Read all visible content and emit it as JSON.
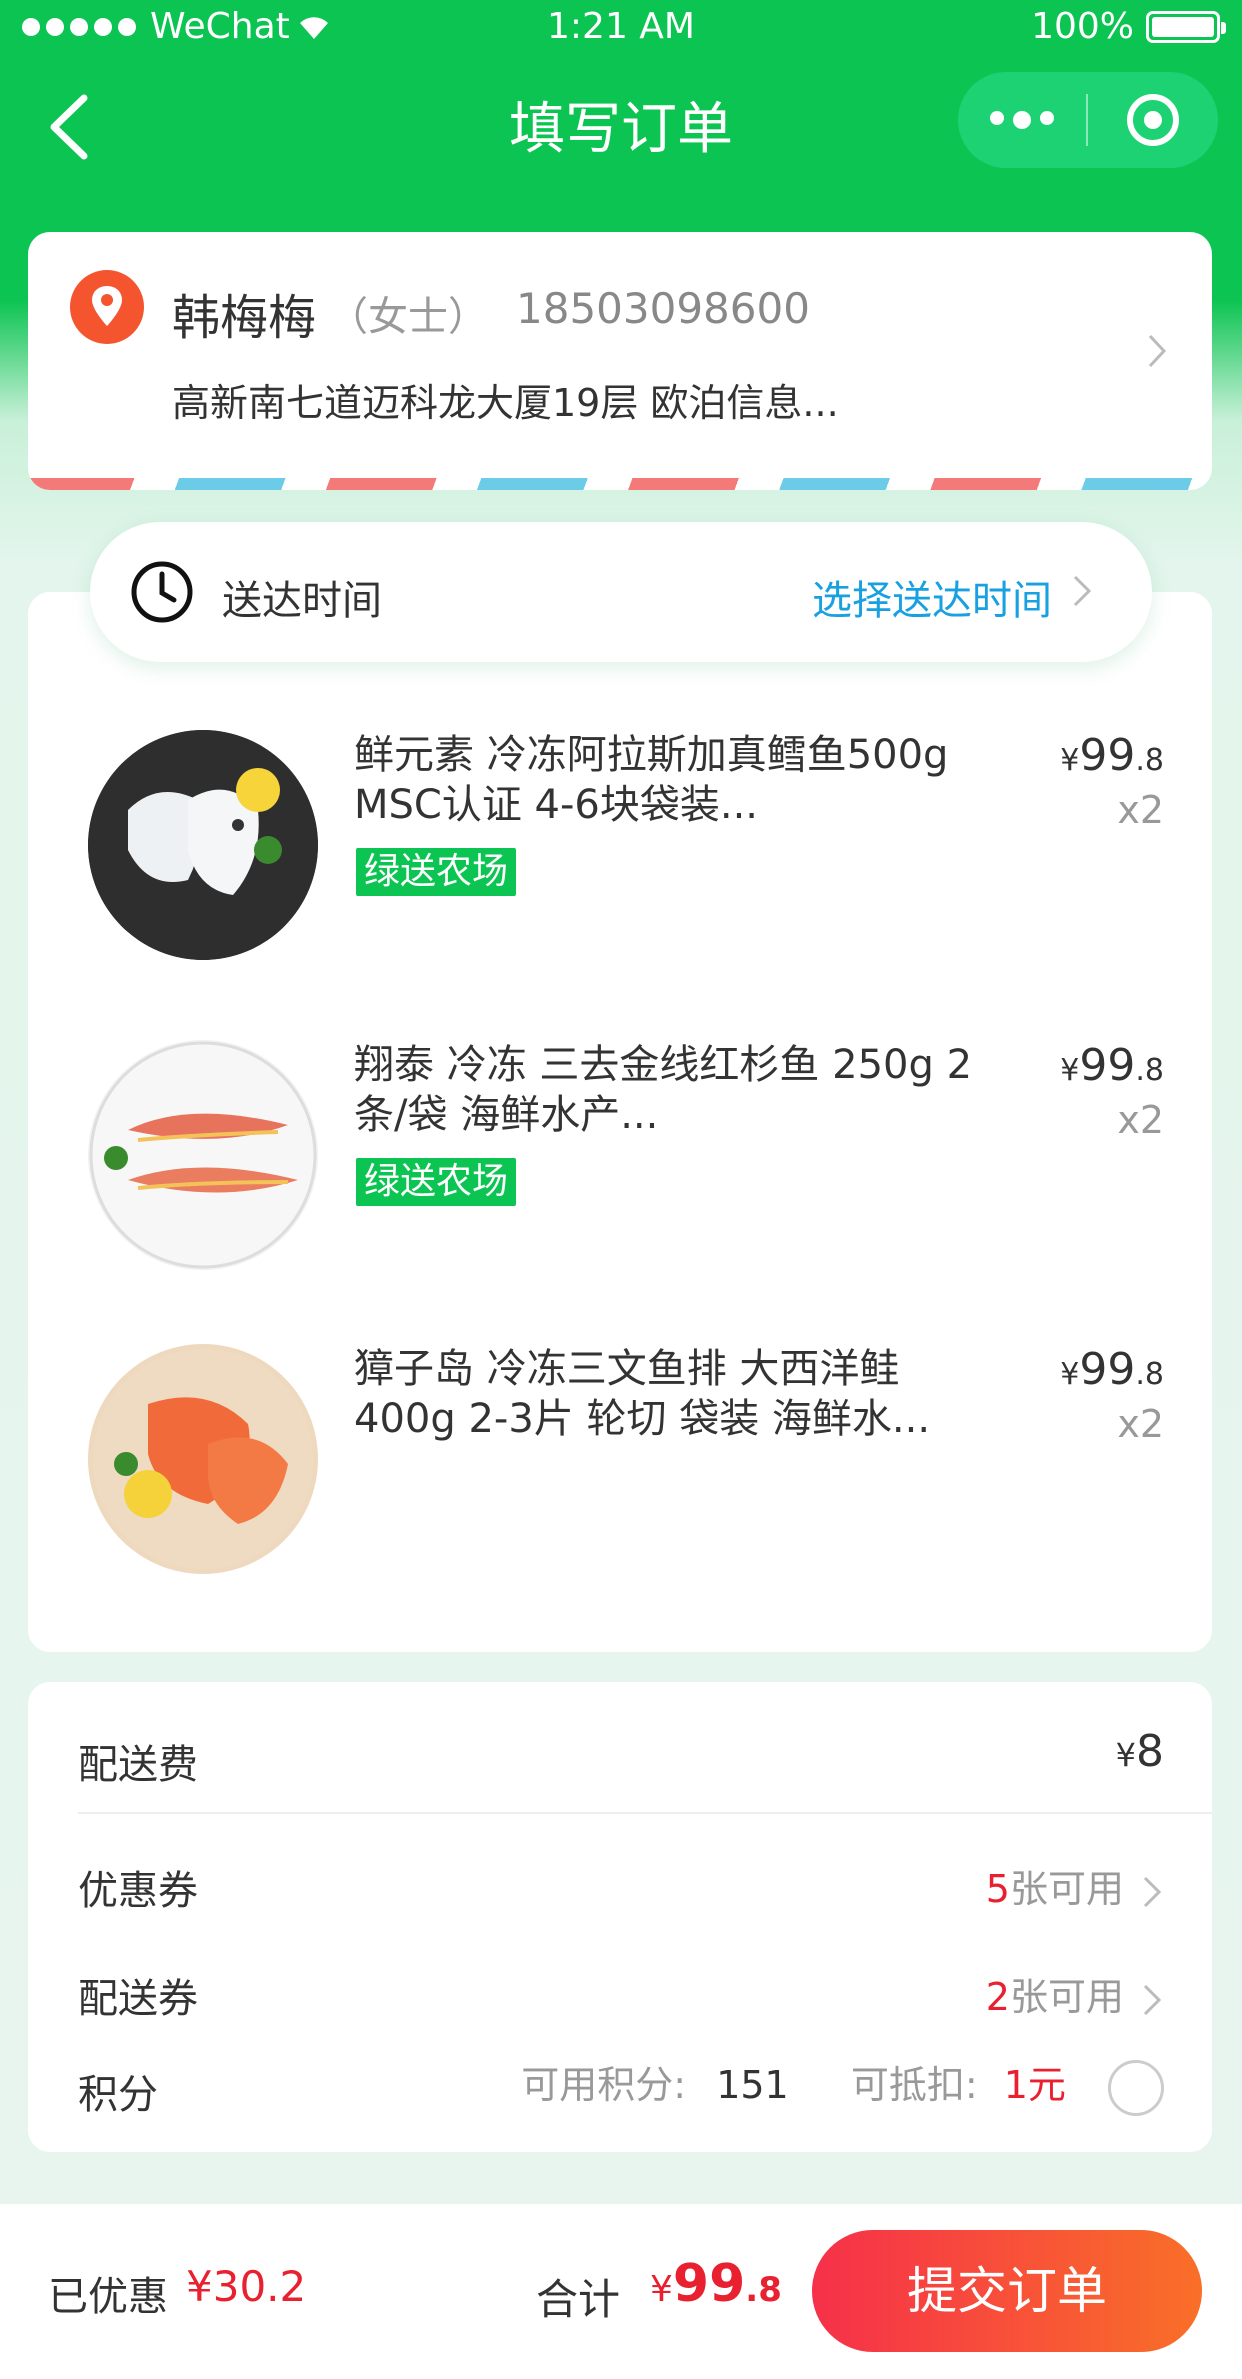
{
  "status_bar": {
    "carrier": "WeChat",
    "time": "1:21 AM",
    "battery": "100%"
  },
  "nav": {
    "title": "填写订单"
  },
  "address": {
    "name": "韩梅梅",
    "title": "（女士）",
    "phone": "18503098600",
    "detail": "高新南七道迈科龙大厦19层 欧泊信息..."
  },
  "delivery": {
    "label": "送达时间",
    "action": "选择送达时间"
  },
  "items": [
    {
      "name": "鲜元素 冷冻阿拉斯加真鳕鱼500g MSC认证 4-6块袋装...",
      "tag": "绿送农场",
      "price_int": "99",
      "price_dec": ".8",
      "currency": "¥",
      "qty": "x2"
    },
    {
      "name": "翔泰 冷冻 三去金线红杉鱼 250g 2条/袋 海鲜水产...",
      "tag": "绿送农场",
      "price_int": "99",
      "price_dec": ".8",
      "currency": "¥",
      "qty": "x2"
    },
    {
      "name": "獐子岛 冷冻三文鱼排 大西洋鲑 400g 2-3片 轮切 袋装 海鲜水...",
      "tag": "",
      "price_int": "99",
      "price_dec": ".8",
      "currency": "¥",
      "qty": "x2"
    }
  ],
  "fees": {
    "shipping_label": "配送费",
    "shipping_currency": "¥",
    "shipping_value": "8",
    "coupon_label": "优惠券",
    "coupon_count": "5",
    "coupon_suffix": "张可用",
    "delivery_coupon_label": "配送券",
    "delivery_coupon_count": "2",
    "delivery_coupon_suffix": "张可用",
    "points_label": "积分",
    "points_available_label": "可用积分:",
    "points_available": "151",
    "points_deduct_label": "可抵扣:",
    "points_deduct": "1元"
  },
  "bottom": {
    "saved_label": "已优惠",
    "saved_value": "¥30.2",
    "total_label": "合计",
    "total_currency": "¥",
    "total_int": "99",
    "total_dec": ".8",
    "submit_label": "提交订单"
  },
  "colors": {
    "brand_green": "#0cc452",
    "price_red": "#e8202f",
    "link_blue": "#18a0e0",
    "submit_start": "#f6304a",
    "submit_end": "#f96f28"
  }
}
